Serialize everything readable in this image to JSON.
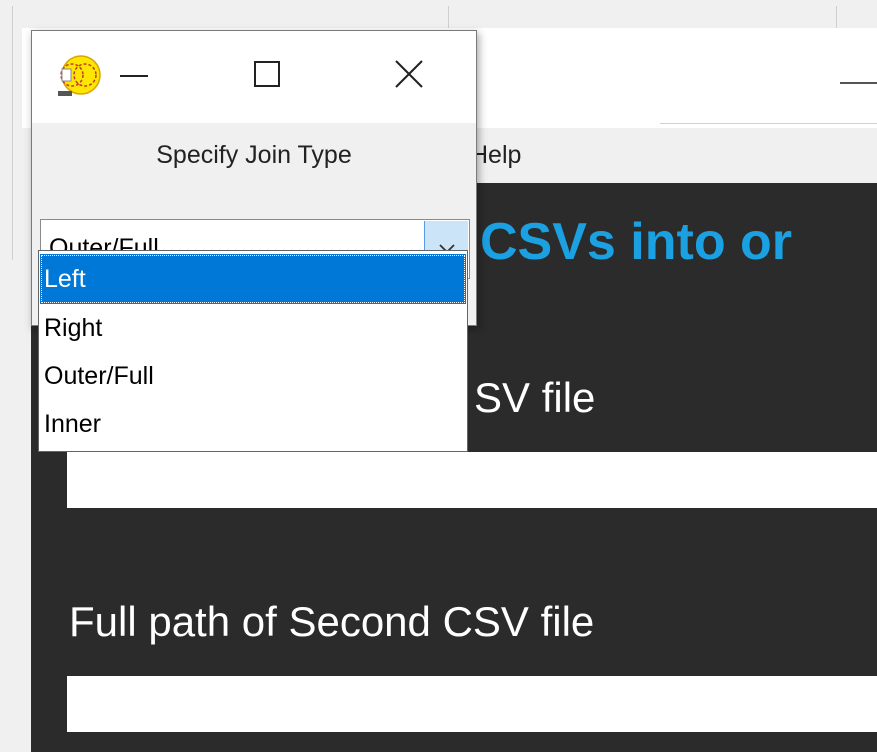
{
  "background_window": {
    "menu_help": "Help",
    "heading_partial": "CSVs into or",
    "label_first_partial": "SV file",
    "label_second": "Full path of Second CSV file",
    "first_path_value": "",
    "second_path_value": ""
  },
  "dialog": {
    "icon": "app-icon",
    "prompt": "Specify Join Type",
    "join_type": {
      "selected_value": "Outer/Full",
      "highlighted_option": "Left",
      "options": [
        "Left",
        "Right",
        "Outer/Full",
        "Inner"
      ]
    }
  },
  "colors": {
    "accent": "#1ba1e2",
    "selection": "#0078d7",
    "dark_panel": "#2b2b2b"
  }
}
